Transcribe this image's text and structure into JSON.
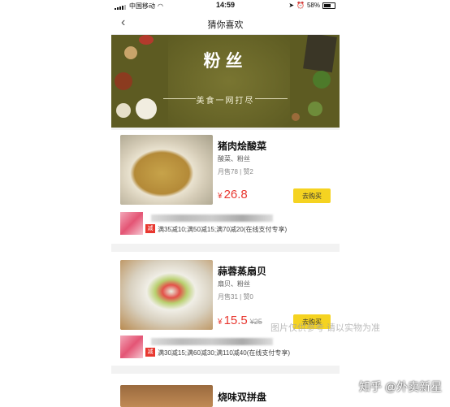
{
  "status_bar": {
    "carrier": "中国移动",
    "time": "14:59",
    "battery": "58%"
  },
  "nav": {
    "back_icon": "‹",
    "title": "猜你喜欢"
  },
  "banner": {
    "title": "粉丝",
    "subtitle": "美食一网打尽"
  },
  "products": [
    {
      "name": "猪肉烩酸菜",
      "tags": "酸菜、粉丝",
      "sales": "月售78",
      "likes": "赞2",
      "currency": "¥",
      "price": "26.8",
      "old_price": "",
      "buy_label": "去购买",
      "promo_badge": "减",
      "promo_text": "满35减10;满50减15;满70减20(在线支付专享)"
    },
    {
      "name": "蒜蓉蒸扇贝",
      "tags": "扇贝、粉丝",
      "sales": "月售31",
      "likes": "赞0",
      "currency": "¥",
      "price": "15.5",
      "old_price": "¥25",
      "buy_label": "去购买",
      "promo_badge": "减",
      "promo_text": "满30减15;满60减30;满110减40(在线支付专享)"
    },
    {
      "name": "烧味双拼盘"
    }
  ],
  "overlay": {
    "watermark": "图片仅供参考 请以实物为准",
    "credit": "知乎 @外卖新星"
  },
  "colors": {
    "price": "#e8372f",
    "buy_button": "#f5d321",
    "banner_bg": "#5d5b22"
  }
}
